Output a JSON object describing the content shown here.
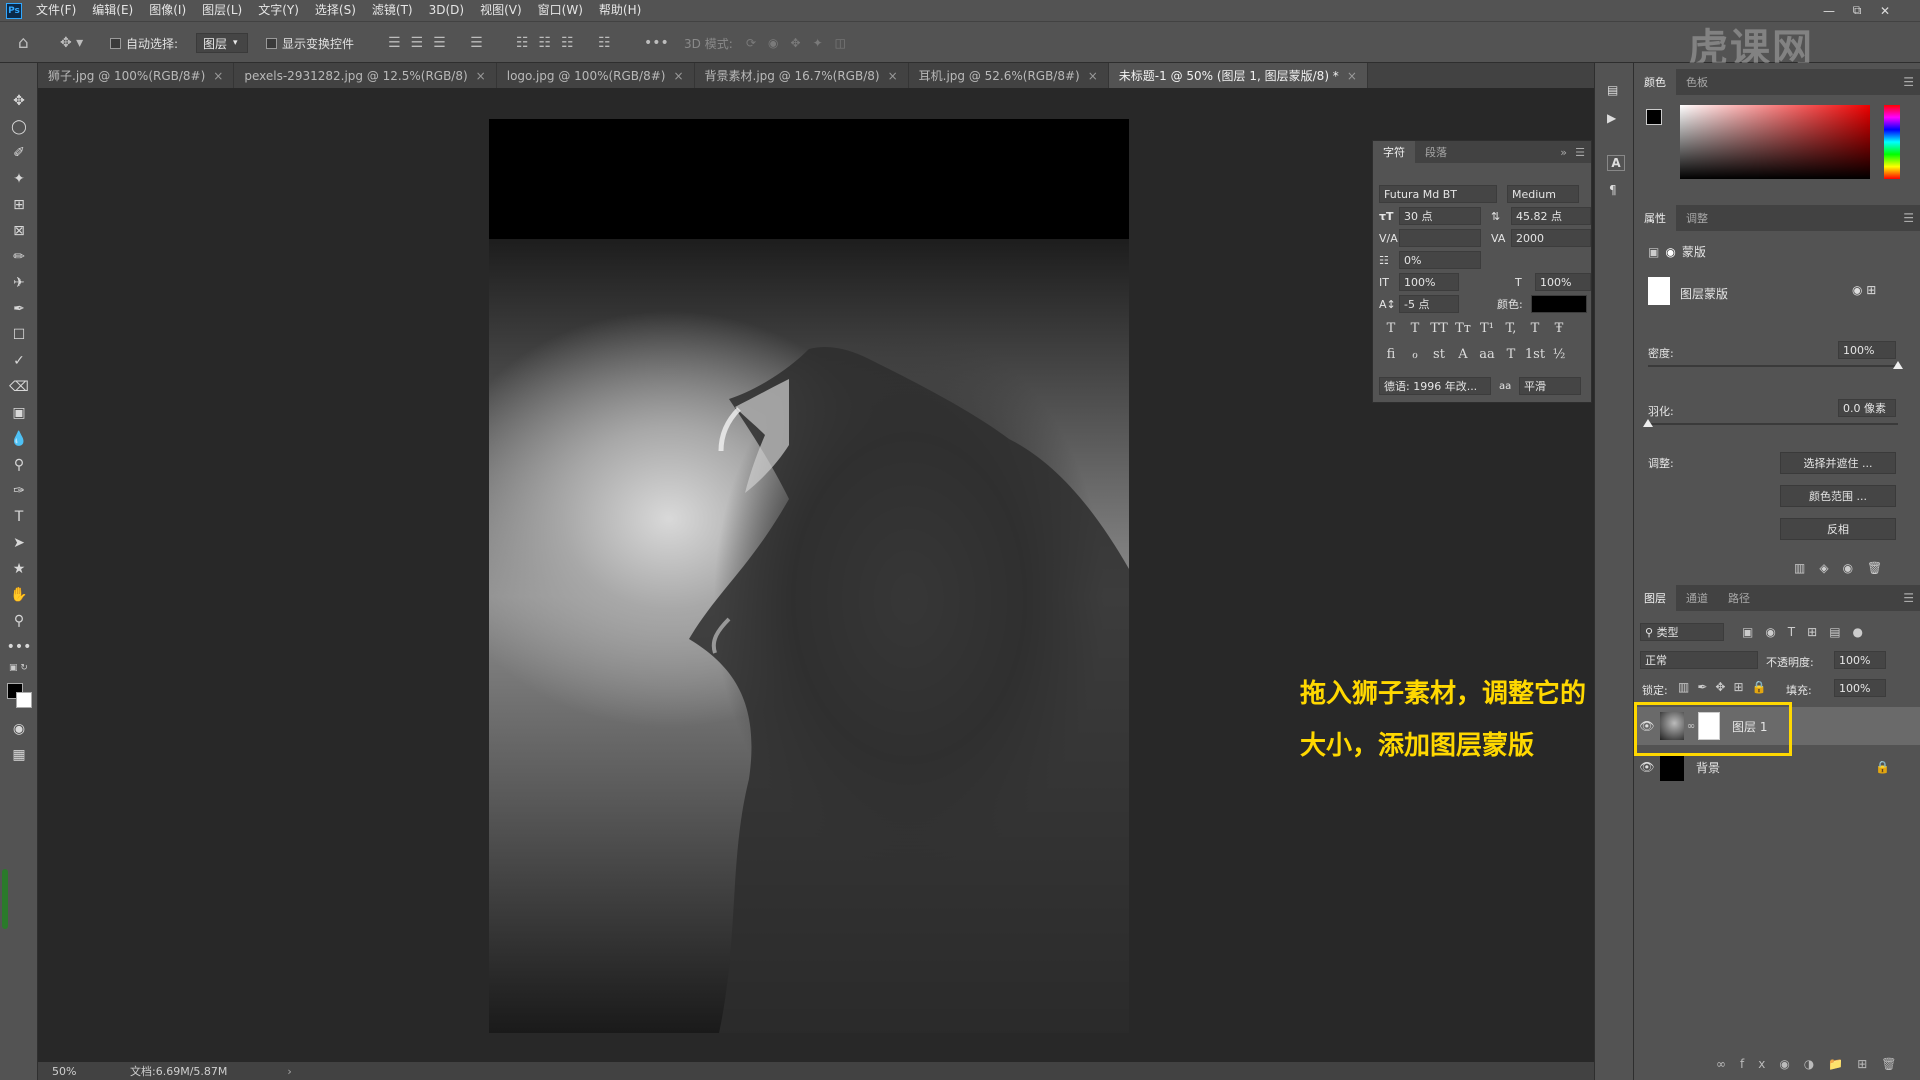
{
  "menubar": {
    "logo": "Ps",
    "items": [
      "文件(F)",
      "编辑(E)",
      "图像(I)",
      "图层(L)",
      "文字(Y)",
      "选择(S)",
      "滤镜(T)",
      "3D(D)",
      "视图(V)",
      "窗口(W)",
      "帮助(H)"
    ]
  },
  "options": {
    "auto_select_label": "自动选择:",
    "auto_select_value": "图层",
    "show_transform_label": "显示变换控件",
    "mode_3d_label": "3D 模式:"
  },
  "tabs": [
    {
      "label": "狮子.jpg @ 100%(RGB/8#)"
    },
    {
      "label": "pexels-2931282.jpg @ 12.5%(RGB/8)"
    },
    {
      "label": "logo.jpg @ 100%(RGB/8#)"
    },
    {
      "label": "背景素材.jpg @ 16.7%(RGB/8)"
    },
    {
      "label": "耳机.jpg @ 52.6%(RGB/8#)"
    },
    {
      "label": "未标题-1 @ 50% (图层 1, 图层蒙版/8) *"
    }
  ],
  "status": {
    "zoom": "50%",
    "doc": "文档:6.69M/5.87M"
  },
  "character_panel": {
    "tab_char": "字符",
    "tab_para": "段落",
    "font_family": "Futura Md BT",
    "font_style": "Medium",
    "size": "30 点",
    "leading": "45.82 点",
    "kerning": "",
    "tracking": "2000",
    "scale_pct": "0%",
    "vscale": "100%",
    "hscale": "100%",
    "baseline": "-5 点",
    "color_label": "颜色:",
    "language": "德语: 1996 年改...",
    "aa_label": "aa",
    "antialias": "平滑",
    "glyph_row1": [
      "T",
      "T",
      "TT",
      "Tт",
      "T¹",
      "T,",
      "T",
      "Ŧ"
    ],
    "glyph_row2": [
      "fi",
      "ℴ",
      "st",
      "A",
      "aa",
      "T",
      "1st",
      "½"
    ]
  },
  "color_panel": {
    "tab_color": "颜色",
    "tab_swatches": "色板"
  },
  "properties_panel": {
    "tab_props": "属性",
    "tab_adjust": "调整",
    "mask_title": "蒙版",
    "mask_layer": "图层蒙版",
    "density_label": "密度:",
    "density_value": "100%",
    "density_fraction": 1.0,
    "feather_label": "羽化:",
    "feather_value": "0.0 像素",
    "feather_fraction": 0.0,
    "adjust_label": "调整:",
    "btn_select_mask": "选择并遮住 ...",
    "btn_color_range": "颜色范围 ...",
    "btn_invert": "反相"
  },
  "layers_panel": {
    "tab_layers": "图层",
    "tab_channels": "通道",
    "tab_paths": "路径",
    "filter_kind": "类型",
    "blend_mode": "正常",
    "opacity_label": "不透明度:",
    "opacity_value": "100%",
    "lock_label": "锁定:",
    "fill_label": "填充:",
    "fill_value": "100%",
    "layers": [
      {
        "name": "图层 1"
      },
      {
        "name": "背景"
      }
    ]
  },
  "annotation": {
    "line1": "拖入狮子素材，调整它的",
    "line2": "大小，添加图层蒙版"
  },
  "watermark": "虎课网"
}
